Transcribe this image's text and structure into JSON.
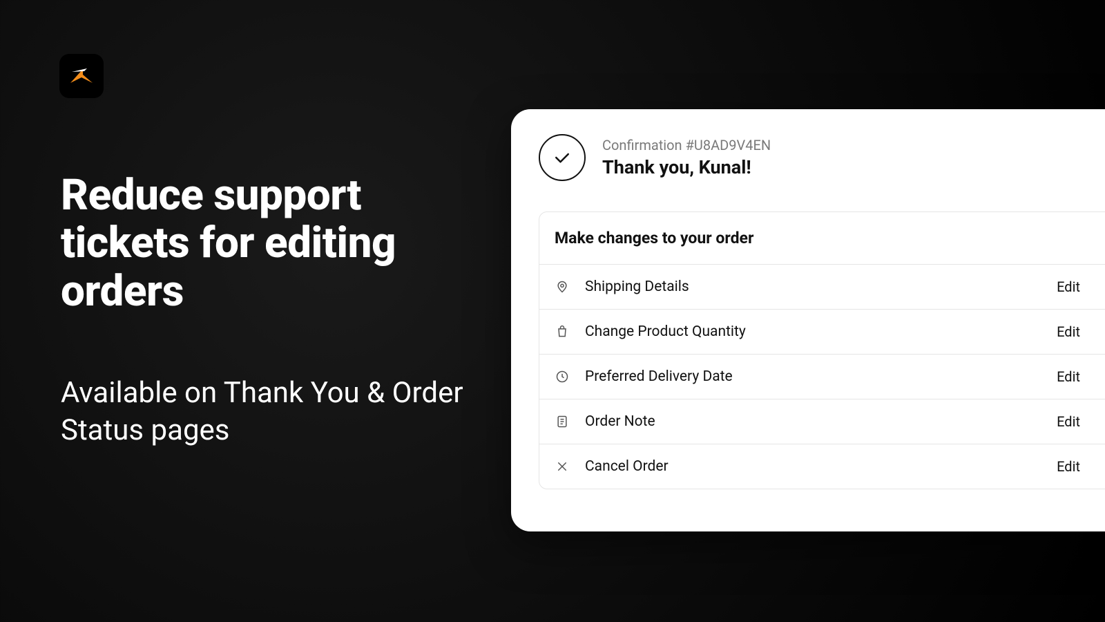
{
  "headline": "Reduce support tickets for editing orders",
  "subhead": "Available on Thank You & Order Status pages",
  "card": {
    "confirmation_label": "Confirmation #U8AD9V4EN",
    "thank_you": "Thank you, Kunal!",
    "panel_title": "Make changes to your order",
    "edit_label": "Edit",
    "rows": [
      {
        "label": "Shipping Details"
      },
      {
        "label": "Change Product Quantity"
      },
      {
        "label": "Preferred Delivery Date"
      },
      {
        "label": "Order Note"
      },
      {
        "label": "Cancel Order"
      }
    ]
  }
}
